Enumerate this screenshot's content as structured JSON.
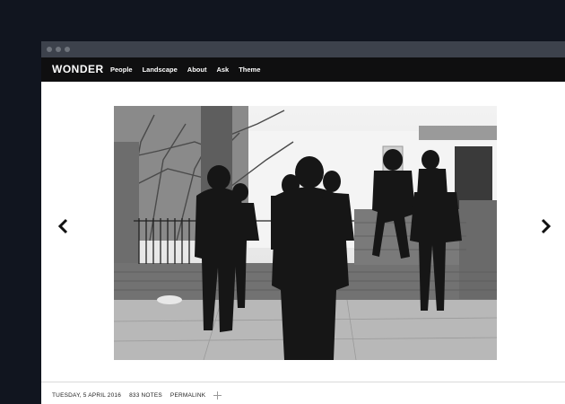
{
  "site": {
    "title": "WONDER",
    "nav": [
      "People",
      "Landscape",
      "About",
      "Ask",
      "Theme"
    ]
  },
  "post": {
    "date": "TUESDAY, 5 APRIL 2016",
    "notes": "833 NOTES",
    "permalink": "PERMALINK"
  },
  "icons": {
    "prev": "chevron-left-icon",
    "next": "chevron-right-icon",
    "add": "plus-icon"
  },
  "colors": {
    "background": "#11151f",
    "navbar": "#0f0f10",
    "titlebar": "#3d424c"
  }
}
